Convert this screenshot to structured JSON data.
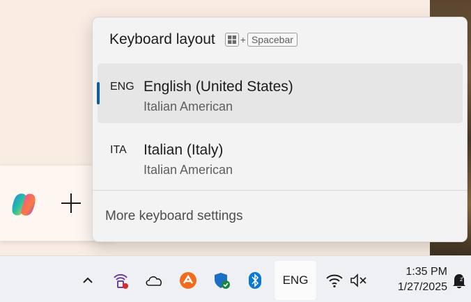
{
  "flyout": {
    "title": "Keyboard layout",
    "shortcut_plus": "+",
    "shortcut_key": "Spacebar",
    "layouts": [
      {
        "code": "ENG",
        "name": "English (United States)",
        "keyboard": "Italian American",
        "selected": true
      },
      {
        "code": "ITA",
        "name": "Italian (Italy)",
        "keyboard": "Italian American",
        "selected": false
      }
    ],
    "more_settings": "More keyboard settings"
  },
  "taskbar": {
    "ime_label": "ENG",
    "time": "1:35 PM",
    "date": "1/27/2025",
    "tray_icons": [
      "chevron-up-icon",
      "vpn-icon",
      "onedrive-icon",
      "avast-icon",
      "defender-icon",
      "bluetooth-icon",
      "wifi-icon",
      "volume-muted-icon",
      "notification-icon"
    ]
  },
  "colors": {
    "accent": "#0a5ea8",
    "flyout_bg": "#f3f3f3",
    "selected_bg": "#e6e6e6",
    "taskbar_bg": "#eef0f3"
  }
}
